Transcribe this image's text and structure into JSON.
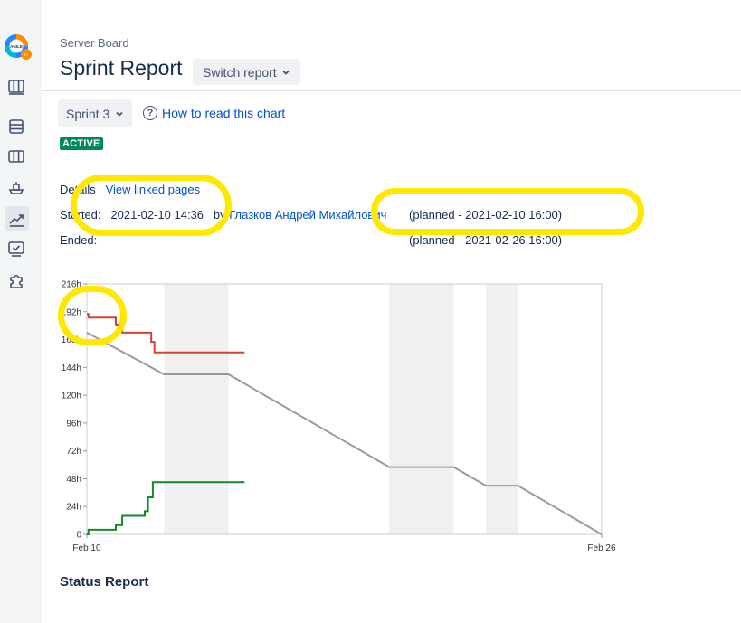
{
  "sidebar": {
    "logo_text": "AGILE",
    "icons": [
      "board-icon",
      "backlog-icon",
      "columns-icon",
      "releases-icon",
      "reports-icon",
      "issues-icon",
      "add-ons-icon"
    ]
  },
  "header": {
    "breadcrumb": "Server Board",
    "title": "Sprint Report",
    "switch_report": "Switch report"
  },
  "sprint": {
    "selected": "Sprint 3",
    "how_to_read": "How to read this chart",
    "status": "ACTIVE"
  },
  "details": {
    "label": "Details",
    "view_linked": "View linked pages",
    "started_label": "Started:",
    "started_value": "2021-02-10 14:36",
    "by_label": "by",
    "user": "Глазков Андрей Михайлович",
    "planned_start": "(planned - 2021-02-10 16:00)",
    "ended_label": "Ended:",
    "planned_end": "(planned - 2021-02-26 16:00)"
  },
  "chart_data": {
    "type": "line",
    "x_ticks": [
      "Feb 10",
      "Feb 26"
    ],
    "y_ticks": [
      "0",
      "24h",
      "48h",
      "72h",
      "96h",
      "120h",
      "144h",
      "168h",
      "192h",
      "216h"
    ],
    "ylim": [
      0,
      216
    ],
    "xlim": [
      0,
      16
    ],
    "nonworking_days": [
      [
        2.4,
        4.4
      ],
      [
        9.4,
        11.4
      ],
      [
        12.4,
        13.4
      ]
    ],
    "series": [
      {
        "color": "#d04437",
        "points": [
          [
            0,
            190
          ],
          [
            0.05,
            190
          ],
          [
            0.05,
            187
          ],
          [
            0.9,
            187
          ],
          [
            0.9,
            181
          ],
          [
            1.1,
            181
          ],
          [
            1.1,
            174
          ],
          [
            2,
            174
          ],
          [
            2,
            166
          ],
          [
            2.1,
            166
          ],
          [
            2.1,
            157
          ],
          [
            4.9,
            157
          ]
        ]
      },
      {
        "color": "#999999",
        "points": [
          [
            0,
            174
          ],
          [
            2.4,
            138
          ],
          [
            4.4,
            138
          ],
          [
            9.4,
            58
          ],
          [
            11.4,
            58
          ],
          [
            12.4,
            42
          ],
          [
            13.4,
            42
          ],
          [
            16,
            0
          ]
        ]
      },
      {
        "color": "#14892c",
        "points": [
          [
            0,
            0
          ],
          [
            0.05,
            0
          ],
          [
            0.05,
            4
          ],
          [
            0.9,
            4
          ],
          [
            0.9,
            8
          ],
          [
            1.1,
            8
          ],
          [
            1.1,
            16
          ],
          [
            1.8,
            16
          ],
          [
            1.8,
            20
          ],
          [
            1.9,
            20
          ],
          [
            1.9,
            32
          ],
          [
            2.05,
            32
          ],
          [
            2.05,
            45
          ],
          [
            4.9,
            45
          ]
        ]
      }
    ]
  },
  "status_report": {
    "title": "Status Report"
  }
}
